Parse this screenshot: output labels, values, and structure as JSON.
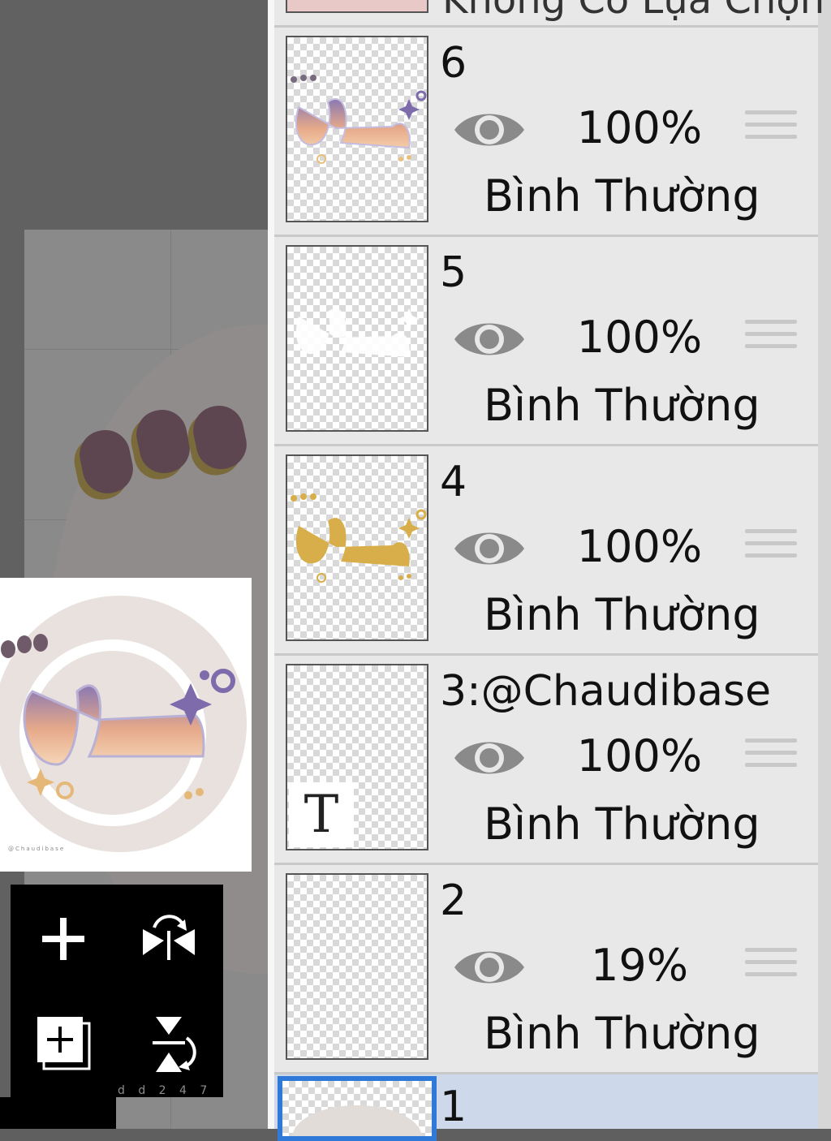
{
  "top_strip_text": "Không Có Lựa Chọn",
  "layers": [
    {
      "name": "6",
      "opacity": "100%",
      "blend": "Bình Thường"
    },
    {
      "name": "5",
      "opacity": "100%",
      "blend": "Bình Thường"
    },
    {
      "name": "4",
      "opacity": "100%",
      "blend": "Bình Thường"
    },
    {
      "name": "3:@Chaudibase",
      "opacity": "100%",
      "blend": "Bình Thường",
      "type_badge": "T"
    },
    {
      "name": "2",
      "opacity": "19%",
      "blend": "Bình Thường"
    },
    {
      "name": "1"
    }
  ],
  "footer_ticks": "d d 2 4 7",
  "colors": {
    "panel_background": "#e8e8e8",
    "selected_row": "#cdd9ea",
    "selected_border": "#2f7ad9",
    "gold": "#d8ae4a",
    "purple": "#7d6bab"
  },
  "icons": [
    "eye-icon",
    "drag-handle-icon",
    "add-layer-icon",
    "flip-horizontal-icon",
    "duplicate-layer-icon",
    "flip-vertical-icon"
  ]
}
